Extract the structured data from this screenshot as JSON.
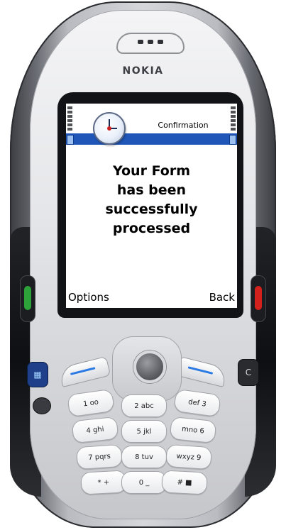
{
  "device": {
    "brand": "NOKIA"
  },
  "screen": {
    "title": "Confirmation",
    "icon": "clock-icon",
    "message_lines": [
      "Your Form",
      "has been",
      "successfully",
      "processed"
    ],
    "softkeys": {
      "left": "Options",
      "right": "Back"
    }
  },
  "keys": {
    "k1": "1 oo",
    "k2": "2 abc",
    "k3": "def 3",
    "k4": "4 ghi",
    "k5": "5 jkl",
    "k6": "mno 6",
    "k7": "7 pqrs",
    "k8": "8 tuv",
    "k9": "wxyz 9",
    "kstar": "* +",
    "k0": "0 _",
    "khash": "# ■"
  },
  "colors": {
    "status_band": "#1f56b8",
    "call_key": "#2ea23a",
    "end_key": "#d3221e",
    "menu_key": "#1f3f8a"
  }
}
